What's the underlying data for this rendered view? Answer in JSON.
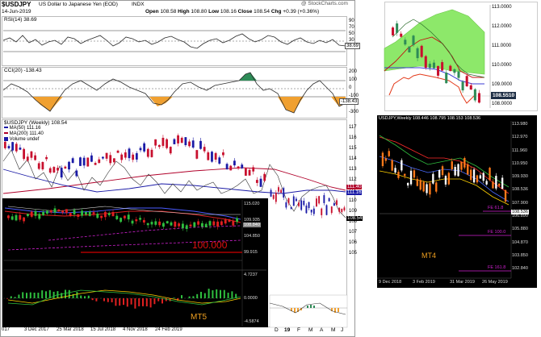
{
  "main_chart": {
    "title": "$USDJPY",
    "subtitle": "US Dollar to Japanese Yen (EOD)",
    "exchange": "INDX",
    "watermark": "@ StockCharts.com",
    "date": "14-Jun-2019",
    "ohlc": {
      "open_label": "Open",
      "open": "108.58",
      "high_label": "High",
      "high": "108.80",
      "low_label": "Low",
      "low": "108.16",
      "close_label": "Close",
      "close": "108.54",
      "chg_label": "Chg",
      "chg": "+0.39 (+0.36%)"
    },
    "rsi_label": "RSI(14) 38.69",
    "rsi_axis": [
      "90",
      "70",
      "50",
      "30",
      "10"
    ],
    "rsi_value_box": "38.69",
    "cci_label": "CCI(20) -138.43",
    "cci_axis": [
      "200",
      "100",
      "0",
      "-100",
      "-200",
      "-300"
    ],
    "cci_value_box": "-138.43",
    "price_label": "$USDJPY (Weekly) 108.54",
    "legend": [
      {
        "text": "MA(50) 111.16",
        "color": "#1a1aa6"
      },
      {
        "text": "MA(200) 111.40",
        "color": "#b0002a"
      },
      {
        "text": "Volume undef",
        "color": "#1a1aa6"
      }
    ],
    "price_axis": [
      "117",
      "116",
      "115",
      "114",
      "113",
      "112",
      "111",
      "110",
      "109",
      "108",
      "107",
      "106",
      "105"
    ],
    "price_boxes": [
      "111.40",
      "111.16",
      "108.54"
    ],
    "x_axis_right": [
      "D",
      "19",
      "F",
      "M",
      "A",
      "M",
      "J"
    ],
    "x_axis_left": [
      "017",
      "3 Dec 2017",
      "25 Mar 2018",
      "15 Jul 2018",
      "4 Nov 2018",
      "24 Feb 2019"
    ]
  },
  "mt5_inset": {
    "axis_values": [
      "115.020",
      "109.935",
      "104.850",
      "99.915"
    ],
    "current_box": "108.840",
    "annotation": "100.000",
    "macd_axis": [
      "4.7237",
      "0.0000",
      "-4.5874"
    ],
    "badge": "MT5"
  },
  "daily_chart": {
    "axis_values": [
      "113.0000",
      "112.0000",
      "111.0000",
      "110.0000",
      "109.0000",
      "108.5510",
      "108.0000"
    ],
    "current_box": "108.5510",
    "colors": {
      "cloud": "#8de86a",
      "baseline": "#3b3bd6",
      "tenkan": "#c41010",
      "lagging": "#e33a1a"
    }
  },
  "mt4_chart": {
    "title": "USDJPY,Weekly  108.446 108.795 108.153 108.536",
    "axis_values": [
      "113.980",
      "112.970",
      "111.960",
      "110.950",
      "109.930",
      "108.536",
      "107.900",
      "106.890",
      "105.880",
      "104.870",
      "103.850",
      "102.840"
    ],
    "current_box": "108.536",
    "fe_labels": [
      "FE 61.8",
      "FE 100.0",
      "FE 161.8"
    ],
    "x_axis": [
      "9 Dec 2018",
      "3 Feb 2019",
      "31 Mar 2019",
      "26 May 2019"
    ],
    "badge": "MT4"
  }
}
